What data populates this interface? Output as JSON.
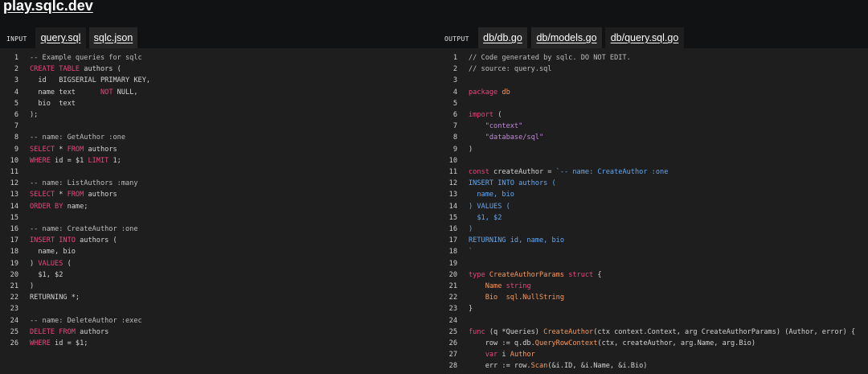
{
  "app": {
    "title": "play.sqlc.dev"
  },
  "colors": {
    "default": "#d4d4d4",
    "comment": "#bdbdbd",
    "keyword": "#e9467f",
    "string": "#c18ad6",
    "type": "#f59b60",
    "blue": "#67a7ec"
  },
  "input": {
    "label": "INPUT",
    "tabs": [
      {
        "label": "query.sql",
        "active": true
      },
      {
        "label": "sqlc.json",
        "active": false
      }
    ],
    "lines": [
      {
        "n": "1",
        "segs": [
          [
            "-- Example queries for sqlc",
            "comment"
          ]
        ]
      },
      {
        "n": "2",
        "segs": [
          [
            "CREATE TABLE",
            "keyword"
          ],
          [
            " authors (",
            "default"
          ]
        ]
      },
      {
        "n": "3",
        "segs": [
          [
            "  id   BIGSERIAL PRIMARY KEY,",
            "default"
          ]
        ]
      },
      {
        "n": "4",
        "segs": [
          [
            "  name text      ",
            "default"
          ],
          [
            "NOT",
            "keyword"
          ],
          [
            " NULL,",
            "default"
          ]
        ]
      },
      {
        "n": "5",
        "segs": [
          [
            "  bio  text",
            "default"
          ]
        ]
      },
      {
        "n": "6",
        "segs": [
          [
            ");",
            "default"
          ]
        ]
      },
      {
        "n": "7",
        "segs": []
      },
      {
        "n": "8",
        "segs": [
          [
            "-- name: GetAuthor :one",
            "comment"
          ]
        ]
      },
      {
        "n": "9",
        "segs": [
          [
            "SELECT",
            "keyword"
          ],
          [
            " * ",
            "default"
          ],
          [
            "FROM",
            "keyword"
          ],
          [
            " authors",
            "default"
          ]
        ]
      },
      {
        "n": "10",
        "segs": [
          [
            "WHERE",
            "keyword"
          ],
          [
            " id = $1 ",
            "default"
          ],
          [
            "LIMIT",
            "keyword"
          ],
          [
            " 1;",
            "default"
          ]
        ]
      },
      {
        "n": "11",
        "segs": []
      },
      {
        "n": "12",
        "segs": [
          [
            "-- name: ListAuthors :many",
            "comment"
          ]
        ]
      },
      {
        "n": "13",
        "segs": [
          [
            "SELECT",
            "keyword"
          ],
          [
            " * ",
            "default"
          ],
          [
            "FROM",
            "keyword"
          ],
          [
            " authors",
            "default"
          ]
        ]
      },
      {
        "n": "14",
        "segs": [
          [
            "ORDER BY",
            "keyword"
          ],
          [
            " name;",
            "default"
          ]
        ]
      },
      {
        "n": "15",
        "segs": []
      },
      {
        "n": "16",
        "segs": [
          [
            "-- name: CreateAuthor :one",
            "comment"
          ]
        ]
      },
      {
        "n": "17",
        "segs": [
          [
            "INSERT INTO",
            "keyword"
          ],
          [
            " authors (",
            "default"
          ]
        ]
      },
      {
        "n": "18",
        "segs": [
          [
            "  name, bio",
            "default"
          ]
        ]
      },
      {
        "n": "19",
        "segs": [
          [
            ") ",
            "default"
          ],
          [
            "VALUES",
            "keyword"
          ],
          [
            " (",
            "default"
          ]
        ]
      },
      {
        "n": "20",
        "segs": [
          [
            "  $1, $2",
            "default"
          ]
        ]
      },
      {
        "n": "21",
        "segs": [
          [
            ")",
            "default"
          ]
        ]
      },
      {
        "n": "22",
        "segs": [
          [
            "RETURNING *;",
            "default"
          ]
        ]
      },
      {
        "n": "23",
        "segs": []
      },
      {
        "n": "24",
        "segs": [
          [
            "-- name: DeleteAuthor :exec",
            "comment"
          ]
        ]
      },
      {
        "n": "25",
        "segs": [
          [
            "DELETE FROM",
            "keyword"
          ],
          [
            " authors",
            "default"
          ]
        ]
      },
      {
        "n": "26",
        "segs": [
          [
            "WHERE",
            "keyword"
          ],
          [
            " id = $1;",
            "default"
          ]
        ]
      }
    ]
  },
  "output": {
    "label": "OUTPUT",
    "tabs": [
      {
        "label": "db/db.go",
        "active": false
      },
      {
        "label": "db/models.go",
        "active": false
      },
      {
        "label": "db/query.sql.go",
        "active": true
      }
    ],
    "lines": [
      {
        "n": "1",
        "segs": [
          [
            "// Code generated by sqlc. DO NOT EDIT.",
            "comment"
          ]
        ]
      },
      {
        "n": "2",
        "segs": [
          [
            "// source: query.sql",
            "comment"
          ]
        ]
      },
      {
        "n": "3",
        "segs": []
      },
      {
        "n": "4",
        "segs": [
          [
            "package",
            "keyword"
          ],
          [
            " db",
            "type"
          ]
        ]
      },
      {
        "n": "5",
        "segs": []
      },
      {
        "n": "6",
        "segs": [
          [
            "import",
            "keyword"
          ],
          [
            " (",
            "default"
          ]
        ]
      },
      {
        "n": "7",
        "segs": [
          [
            "    \"context\"",
            "string"
          ]
        ]
      },
      {
        "n": "8",
        "segs": [
          [
            "    \"database/sql\"",
            "string"
          ]
        ]
      },
      {
        "n": "9",
        "segs": [
          [
            ")",
            "default"
          ]
        ]
      },
      {
        "n": "10",
        "segs": []
      },
      {
        "n": "11",
        "segs": [
          [
            "const",
            "keyword"
          ],
          [
            " createAuthor = ",
            "default"
          ],
          [
            "`-- name: CreateAuthor :one",
            "blue"
          ]
        ]
      },
      {
        "n": "12",
        "segs": [
          [
            "INSERT INTO authors (",
            "blue"
          ]
        ]
      },
      {
        "n": "13",
        "segs": [
          [
            "  name, bio",
            "blue"
          ]
        ]
      },
      {
        "n": "14",
        "segs": [
          [
            ") VALUES (",
            "blue"
          ]
        ]
      },
      {
        "n": "15",
        "segs": [
          [
            "  $1, $2",
            "blue"
          ]
        ]
      },
      {
        "n": "16",
        "segs": [
          [
            ")",
            "blue"
          ]
        ]
      },
      {
        "n": "17",
        "segs": [
          [
            "RETURNING id, name, bio",
            "blue"
          ]
        ]
      },
      {
        "n": "18",
        "segs": [
          [
            "`",
            "blue"
          ]
        ]
      },
      {
        "n": "19",
        "segs": []
      },
      {
        "n": "20",
        "segs": [
          [
            "type",
            "keyword"
          ],
          [
            " CreateAuthorParams ",
            "type"
          ],
          [
            "struct",
            "keyword"
          ],
          [
            " {",
            "default"
          ]
        ]
      },
      {
        "n": "21",
        "segs": [
          [
            "    Name ",
            "type"
          ],
          [
            "string",
            "keyword"
          ]
        ]
      },
      {
        "n": "22",
        "segs": [
          [
            "    Bio  ",
            "type"
          ],
          [
            "sql.NullString",
            "type"
          ]
        ]
      },
      {
        "n": "23",
        "segs": [
          [
            "}",
            "default"
          ]
        ]
      },
      {
        "n": "24",
        "segs": []
      },
      {
        "n": "25",
        "segs": [
          [
            "func",
            "keyword"
          ],
          [
            " (q *Queries) ",
            "default"
          ],
          [
            "CreateAuthor",
            "type"
          ],
          [
            "(ctx context.Context, arg CreateAuthorParams) (Author, error) {",
            "default"
          ]
        ]
      },
      {
        "n": "26",
        "segs": [
          [
            "    row := q.db.",
            "default"
          ],
          [
            "QueryRowContext",
            "type"
          ],
          [
            "(ctx, createAuthor, arg.Name, arg.Bio)",
            "default"
          ]
        ]
      },
      {
        "n": "27",
        "segs": [
          [
            "    ",
            "default"
          ],
          [
            "var",
            "keyword"
          ],
          [
            " i ",
            "default"
          ],
          [
            "Author",
            "type"
          ]
        ]
      },
      {
        "n": "28",
        "segs": [
          [
            "    err := row.",
            "default"
          ],
          [
            "Scan",
            "type"
          ],
          [
            "(&i.ID, &i.Name, &i.Bio)",
            "default"
          ]
        ]
      }
    ]
  }
}
